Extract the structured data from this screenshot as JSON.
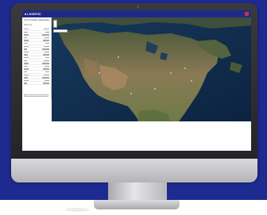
{
  "app": {
    "logo_text": "■ LOGISTIC",
    "accent": "#1f2a88",
    "close_color": "#cc3344"
  },
  "sidebar": {
    "title": "Ver Por Estado (Solicitudes)",
    "filter_label": "Filtrar por:"
  },
  "map": {
    "layer": "satellite"
  },
  "device": {
    "frame_color": "#2c2c30",
    "background_color": "#1d2a8f"
  }
}
